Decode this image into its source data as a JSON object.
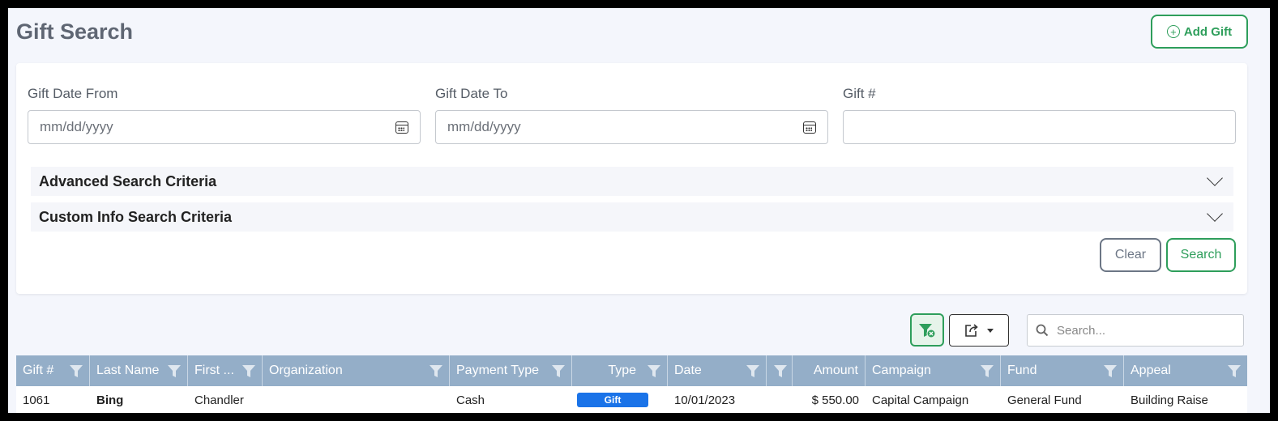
{
  "page": {
    "title": "Gift Search",
    "add_button_label": "Add Gift"
  },
  "search_form": {
    "gift_date_from": {
      "label": "Gift Date From",
      "placeholder": "mm/dd/yyyy",
      "value": ""
    },
    "gift_date_to": {
      "label": "Gift Date To",
      "placeholder": "mm/dd/yyyy",
      "value": ""
    },
    "gift_number": {
      "label": "Gift #",
      "value": ""
    },
    "advanced_criteria_label": "Advanced Search Criteria",
    "custom_info_criteria_label": "Custom Info Search Criteria",
    "clear_label": "Clear",
    "search_label": "Search"
  },
  "grid_toolbar": {
    "search_placeholder": "Search..."
  },
  "grid": {
    "columns": [
      "Gift #",
      "Last Name",
      "First ...",
      "Organization",
      "Payment Type",
      "Type",
      "Date",
      "",
      "Amount",
      "Campaign",
      "Fund",
      "Appeal"
    ],
    "rows": [
      {
        "gift_number": "1061",
        "last_name": "Bing",
        "first_name": "Chandler",
        "organization": "",
        "payment_type": "Cash",
        "type": "Gift",
        "date": "10/01/2023",
        "extra": "",
        "amount": "$ 550.00",
        "campaign": "Capital Campaign",
        "fund": "General Fund",
        "appeal": "Building Raise"
      }
    ]
  },
  "colors": {
    "accent_green": "#2e9e5b",
    "header_blue": "#94aec8",
    "badge_blue": "#1a73e8",
    "page_bg": "#f4f6fc"
  },
  "icons": {
    "add": "plus-circle-icon",
    "calendar": "calendar-icon",
    "chevron": "chevron-down-icon",
    "filter_clear": "filter-clear-icon",
    "export": "export-icon",
    "search": "search-icon",
    "column_filter": "funnel-icon"
  }
}
